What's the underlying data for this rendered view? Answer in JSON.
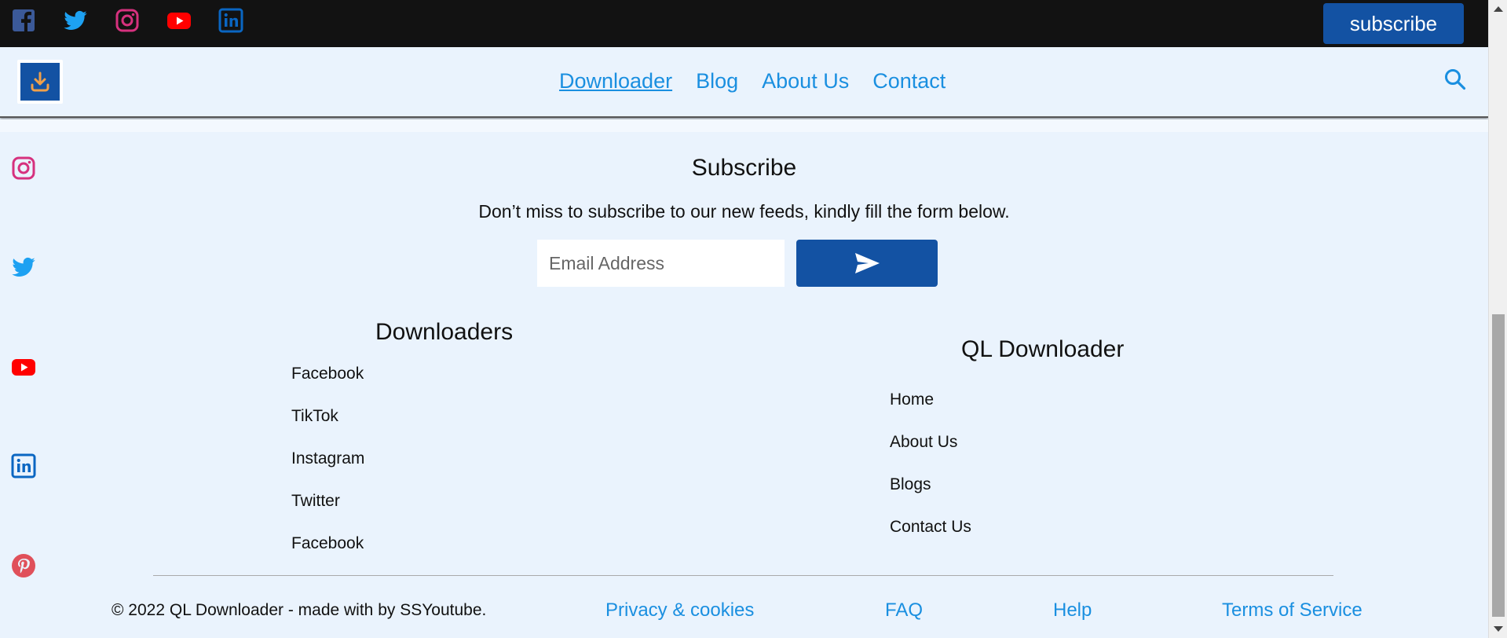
{
  "topbar": {
    "social_icons": [
      "facebook-icon",
      "twitter-icon",
      "instagram-icon",
      "youtube-icon",
      "linkedin-icon"
    ],
    "subscribe_label": "subscribe"
  },
  "nav": {
    "logo_icon": "download-icon",
    "links": [
      {
        "label": "Downloader",
        "active": true
      },
      {
        "label": "Blog",
        "active": false
      },
      {
        "label": "About Us",
        "active": false
      },
      {
        "label": "Contact",
        "active": false
      }
    ],
    "search_icon": "search-icon"
  },
  "side_social_icons": [
    "instagram-icon",
    "twitter-icon",
    "youtube-icon",
    "linkedin-icon",
    "pinterest-icon"
  ],
  "subscribe": {
    "title": "Subscribe",
    "text": "Don’t miss to subscribe to our new feeds, kindly fill the form below.",
    "email_placeholder": "Email Address",
    "email_value": "",
    "send_icon": "send-icon"
  },
  "downloaders": {
    "title": "Downloaders",
    "links": [
      "Facebook",
      "TikTok",
      "Instagram",
      "Twitter",
      "Facebook"
    ]
  },
  "ql": {
    "title": "QL Downloader",
    "links": [
      "Home",
      "About Us",
      "Blogs",
      "Contact Us"
    ]
  },
  "footer": {
    "copyright": "© 2022 QL Downloader - made with by SSYoutube.",
    "links": [
      "Privacy & cookies",
      "FAQ",
      "Help",
      "Terms of Service"
    ]
  },
  "colors": {
    "brand_blue": "#1352a3",
    "link_blue": "#1a8fe0",
    "background": "#eaf3fd",
    "topbar": "#121212"
  }
}
